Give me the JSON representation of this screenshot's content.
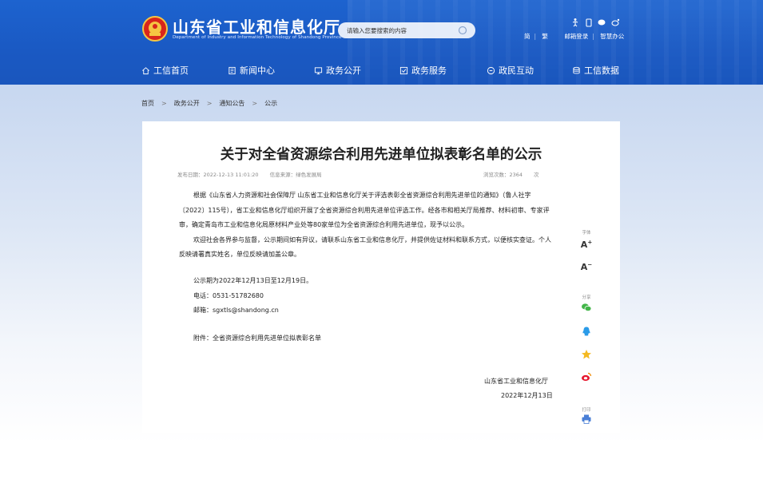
{
  "site": {
    "title": "山东省工业和信息化厅",
    "subtitle": "Department of Industry and Information Technology of Shandong Province"
  },
  "search": {
    "placeholder": "请输入您要搜索的内容"
  },
  "toolbar": {
    "links": [
      "简",
      "繁",
      "邮箱登录",
      "智慧办公"
    ],
    "icons": [
      "accessibility-icon",
      "mobile-icon",
      "chat-icon",
      "weibo-icon"
    ]
  },
  "nav": {
    "items": [
      {
        "label": "工信首页",
        "icon": "home-icon"
      },
      {
        "label": "新闻中心",
        "icon": "news-icon"
      },
      {
        "label": "政务公开",
        "icon": "monitor-icon"
      },
      {
        "label": "政务服务",
        "icon": "service-icon"
      },
      {
        "label": "政民互动",
        "icon": "interaction-icon"
      },
      {
        "label": "工信数据",
        "icon": "database-icon"
      }
    ]
  },
  "breadcrumb": {
    "items": [
      "首页",
      "政务公开",
      "通知公告",
      "公示"
    ],
    "separator": ">"
  },
  "article": {
    "title": "关于对全省资源综合利用先进单位拟表彰名单的公示",
    "date": "发布日期：2022-12-13 11:01:20",
    "source": "信息来源：绿色发展局",
    "views_label": "浏览次数：",
    "views": "2364",
    "views_unit": "次",
    "paragraph1": "根据《山东省人力资源和社会保障厅 山东省工业和信息化厅关于评选表彰全省资源综合利用先进单位的通知》（鲁人社字〔2022〕115号），省工业和信息化厅组织开展了全省资源综合利用先进单位评选工作。经各市和相关厅局推荐、材料初审、专家评审，确定青岛市工业和信息化局原材料产业处等80家单位为全省资源综合利用先进单位，现予以公示。",
    "paragraph2": "欢迎社会各界参与监督，公示期间如有异议，请联系山东省工业和信息化厅，并提供佐证材料和联系方式，以便核实查证。个人反映请署真实姓名，单位反映请加盖公章。",
    "period": "公示期为2022年12月13日至12月19日。",
    "phone": "电话：0531-51782680",
    "email": "邮箱：sgxtls@shandong.cn",
    "attachment": "附件：全省资源综合利用先进单位拟表彰名单",
    "sign_org": "山东省工业和信息化厅",
    "sign_date": "2022年12月13日"
  },
  "side_tools": {
    "font_label": "字体",
    "font_up": "A",
    "font_down": "A",
    "share_label": "分享",
    "print_label": "打印"
  },
  "colors": {
    "header": "#1a59c3",
    "accent": "#2f6fd1"
  }
}
